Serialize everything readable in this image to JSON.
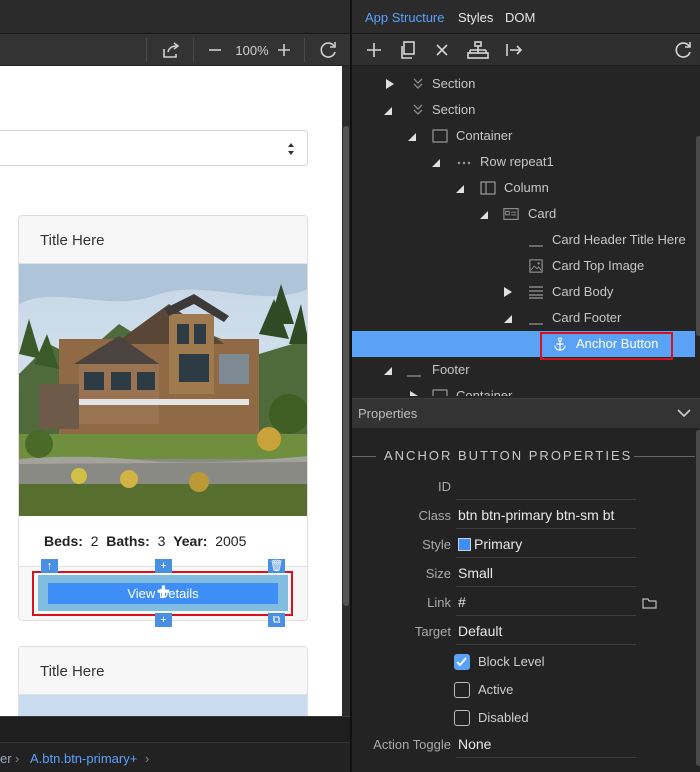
{
  "panel": {
    "tabs": [
      {
        "label": "App Structure",
        "active": true
      },
      {
        "label": "Styles",
        "active": false
      },
      {
        "label": "DOM",
        "active": false
      }
    ]
  },
  "canvas": {
    "zoom": "100%",
    "cards": [
      {
        "title": "Title Here",
        "beds_label": "Beds:",
        "beds": "2",
        "baths_label": "Baths:",
        "baths": "3",
        "year_label": "Year:",
        "year": "2005",
        "button": "View Details"
      },
      {
        "title": "Title Here"
      }
    ]
  },
  "breadcrumb": {
    "prev": "er",
    "current": "A.btn.btn-primary+"
  },
  "tree": {
    "nodes": [
      {
        "label": "Section"
      },
      {
        "label": "Section"
      },
      {
        "label": "Container"
      },
      {
        "label": "Row repeat1"
      },
      {
        "label": "Column"
      },
      {
        "label": "Card"
      },
      {
        "label": "Card Header Title Here"
      },
      {
        "label": "Card Top Image"
      },
      {
        "label": "Card Body"
      },
      {
        "label": "Card Footer"
      },
      {
        "label": "Anchor Button"
      },
      {
        "label": "Footer"
      },
      {
        "label": "Container"
      }
    ]
  },
  "properties": {
    "header": "Properties",
    "title": "ANCHOR BUTTON PROPERTIES",
    "fields": {
      "id": {
        "label": "ID",
        "value": ""
      },
      "class": {
        "label": "Class",
        "value": "btn btn-primary btn-sm bt"
      },
      "style": {
        "label": "Style",
        "value": "Primary"
      },
      "size": {
        "label": "Size",
        "value": "Small"
      },
      "link": {
        "label": "Link",
        "value": "#"
      },
      "target": {
        "label": "Target",
        "value": "Default"
      },
      "action_toggle": {
        "label": "Action Toggle",
        "value": "None"
      }
    },
    "checkboxes": {
      "block_level": {
        "label": "Block Level",
        "checked": true
      },
      "active": {
        "label": "Active",
        "checked": false
      },
      "disabled": {
        "label": "Disabled",
        "checked": false
      }
    }
  },
  "colors": {
    "accent": "#5aa2f5",
    "selection": "#d6131c",
    "button": "#3f8ef6"
  }
}
